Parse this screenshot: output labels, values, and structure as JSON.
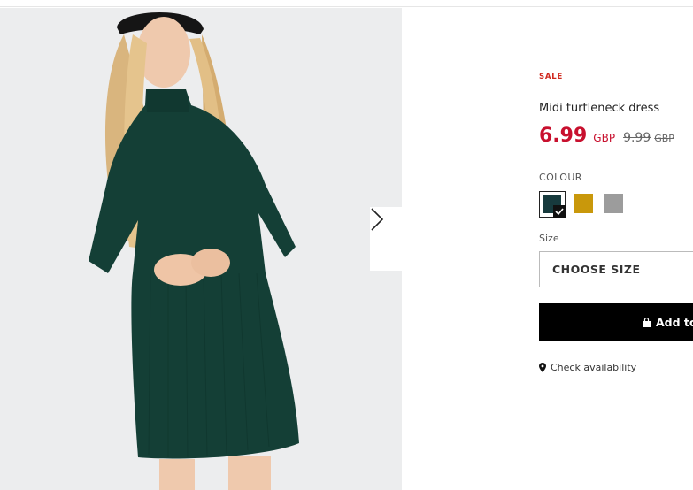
{
  "product": {
    "sale_badge": "SALE",
    "title": "Midi turtleneck dress",
    "price_now": "6.99",
    "currency_now": "GBP",
    "price_was": "9.99",
    "currency_was": "GBP",
    "colour_label": "COLOUR",
    "colours": [
      {
        "name": "dark-green",
        "hex": "#173a3d",
        "selected": true
      },
      {
        "name": "mustard",
        "hex": "#c9980b",
        "selected": false
      },
      {
        "name": "grey",
        "hex": "#9c9c9c",
        "selected": false
      }
    ],
    "size_label": "Size",
    "size_placeholder": "CHOOSE SIZE",
    "add_button_label": "Add to",
    "check_availability": "Check availability"
  },
  "gallery": {
    "next_icon": "chevron-right-icon",
    "image_description_icon": "product-photo"
  },
  "colors": {
    "sale_red": "#c8102e",
    "button_black": "#000000",
    "background_grey": "#ecedee"
  }
}
